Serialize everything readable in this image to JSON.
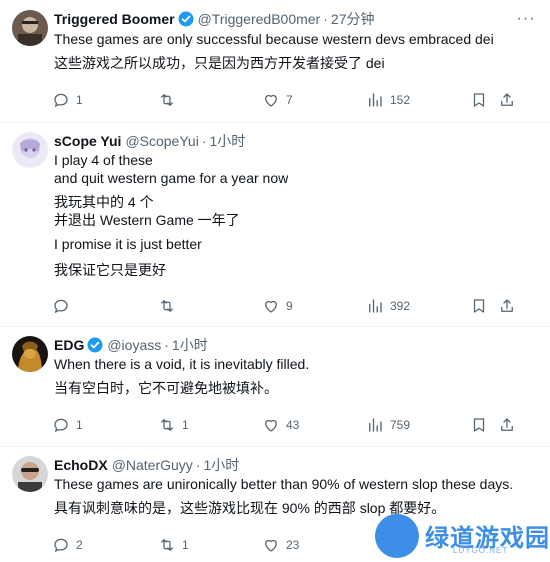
{
  "tweets": [
    {
      "name": "Triggered Boomer",
      "verified": true,
      "handle": "@TriggeredB00mer",
      "sep": "·",
      "time": "27分钟",
      "lines": [
        "These games are only successful because western devs embraced dei",
        "这些游戏之所以成功，只是因为西方开发者接受了 dei"
      ],
      "replies": "1",
      "retweets": "",
      "likes": "7",
      "views": "152"
    },
    {
      "name": "sCope Yui",
      "verified": false,
      "handle": "@ScopeYui",
      "sep": "·",
      "time": "1小时",
      "lines": [
        "I play 4 of these",
        "and quit western game for a year now",
        "我玩其中的 4 个",
        "并退出 Western Game 一年了",
        "I promise it is just better",
        "我保证它只是更好"
      ],
      "replies": "",
      "retweets": "",
      "likes": "9",
      "views": "392"
    },
    {
      "name": "EDG",
      "verified": true,
      "handle": "@ioyass",
      "sep": "·",
      "time": "1小时",
      "lines": [
        "When there is a void, it is inevitably filled.",
        "当有空白时，它不可避免地被填补。"
      ],
      "replies": "1",
      "retweets": "1",
      "likes": "43",
      "views": "759"
    },
    {
      "name": "EchoDX",
      "verified": false,
      "handle": "@NaterGuyy",
      "sep": "·",
      "time": "1小时",
      "lines": [
        "These games are unironically better than 90% of western slop these days.",
        "具有讽刺意味的是，这些游戏比现在 90% 的西部 slop 都要好。"
      ],
      "replies": "2",
      "retweets": "1",
      "likes": "23",
      "views": ""
    }
  ],
  "more_label": "···",
  "watermark": {
    "title": "绿道游戏园",
    "subtitle": "LDYGO.NET"
  },
  "colors": {
    "accent": "#1d9bf0",
    "muted": "#536471",
    "text": "#0f1419",
    "watermark": "#3d8ee6"
  },
  "icons": [
    "reply-icon",
    "retweet-icon",
    "like-icon",
    "views-icon",
    "bookmark-icon",
    "share-icon",
    "verified-badge-icon",
    "more-icon"
  ]
}
